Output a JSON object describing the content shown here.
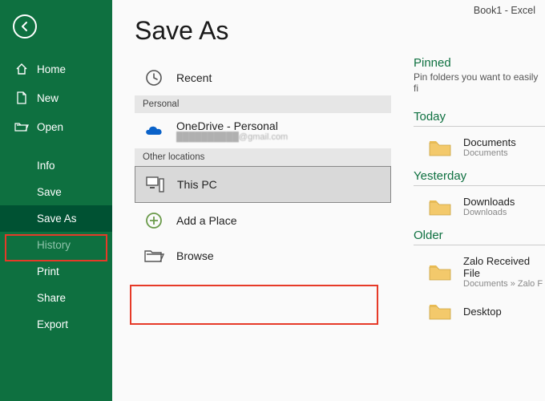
{
  "titlebar": "Book1 - Excel",
  "page_title": "Save As",
  "sidebar": {
    "home": "Home",
    "new": "New",
    "open": "Open",
    "info": "Info",
    "save": "Save",
    "save_as": "Save As",
    "history": "History",
    "print": "Print",
    "share": "Share",
    "export": "Export"
  },
  "locations": {
    "recent": "Recent",
    "personal_header": "Personal",
    "onedrive": "OneDrive - Personal",
    "onedrive_sub": "██████████@gmail.com",
    "other_header": "Other locations",
    "thispc": "This PC",
    "addplace": "Add a Place",
    "browse": "Browse"
  },
  "rightpane": {
    "pinned_title": "Pinned",
    "pinned_desc": "Pin folders you want to easily fi",
    "today": "Today",
    "yesterday": "Yesterday",
    "older": "Older",
    "folders": {
      "documents": {
        "name": "Documents",
        "path": "Documents"
      },
      "downloads": {
        "name": "Downloads",
        "path": "Downloads"
      },
      "zalo": {
        "name": "Zalo Received File",
        "path": "Documents » Zalo F"
      },
      "desktop": {
        "name": "Desktop",
        "path": ""
      }
    }
  }
}
